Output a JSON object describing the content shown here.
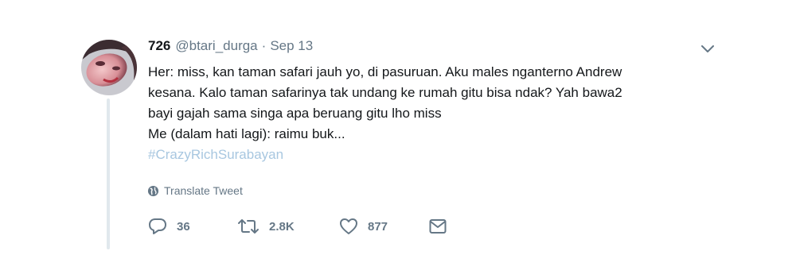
{
  "tweet": {
    "display_name": "726",
    "handle": "@btari_durga",
    "separator": "·",
    "date": "Sep 13",
    "text_lines": [
      "Her: miss, kan taman safari jauh yo, di pasuruan. Aku males nganterno Andrew",
      "kesana. Kalo taman safarinya tak undang ke rumah gitu bisa ndak? Yah bawa2",
      "bayi gajah sama singa apa beruang gitu lho miss",
      "Me (dalam hati lagi): raimu buk..."
    ],
    "hashtag": "#CrazyRichSurabayan",
    "translate_label": "Translate Tweet",
    "actions": {
      "replies": "36",
      "retweets": "2.8K",
      "likes": "877"
    }
  },
  "icons": {
    "caret": "chevron-down-icon",
    "translate": "globe-icon",
    "reply": "reply-icon",
    "retweet": "retweet-icon",
    "like": "heart-icon",
    "message": "envelope-icon"
  },
  "colors": {
    "text": "#14171a",
    "secondary": "#657786",
    "hashtag": "#a8c7e0",
    "thread_line": "#e1e8ed"
  }
}
